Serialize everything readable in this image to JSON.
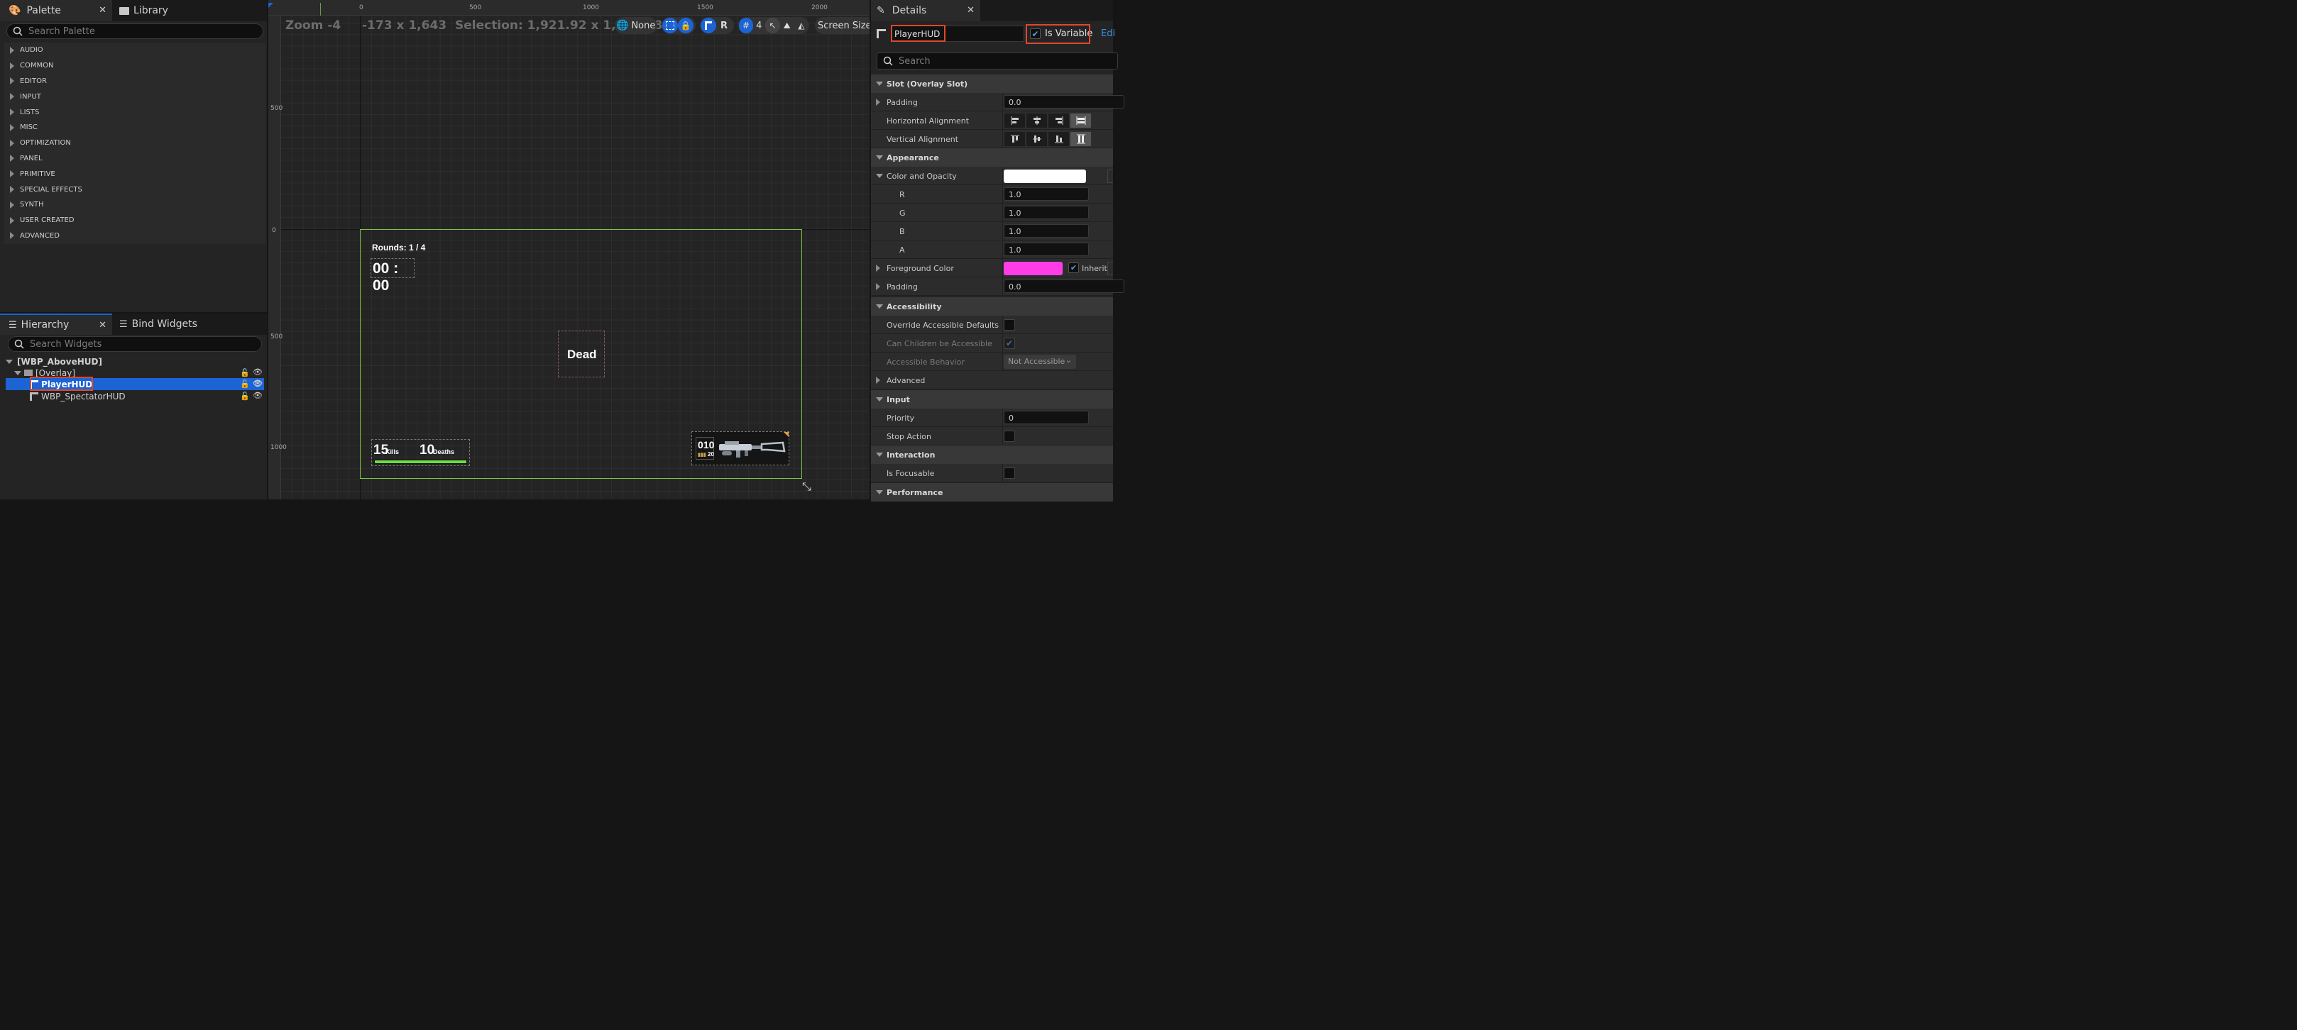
{
  "palette": {
    "tab_label": "Palette",
    "library_tab_label": "Library",
    "search_placeholder": "Search Palette",
    "categories": [
      "AUDIO",
      "COMMON",
      "EDITOR",
      "INPUT",
      "LISTS",
      "MISC",
      "OPTIMIZATION",
      "PANEL",
      "PRIMITIVE",
      "SPECIAL EFFECTS",
      "SYNTH",
      "USER CREATED",
      "ADVANCED"
    ]
  },
  "hierarchy": {
    "tab_label": "Hierarchy",
    "bind_tab_label": "Bind Widgets",
    "search_placeholder": "Search Widgets",
    "root": "[WBP_AboveHUD]",
    "overlay": "[Overlay]",
    "item_player": "PlayerHUD",
    "item_spectator": "WBP_SpectatorHUD"
  },
  "designer": {
    "zoom": "Zoom -4",
    "coords": "-173 x 1,643",
    "selection": "Selection: 1,921.92 x 1,081.08",
    "none_label": "None",
    "r_label": "R",
    "grid_count": "4",
    "screen_size": "Screen Size",
    "ruler_top": [
      "0",
      "500",
      "1000",
      "1500",
      "2000"
    ],
    "ruler_left": [
      "500",
      "0",
      "500",
      "1000"
    ]
  },
  "hud": {
    "rounds": "Rounds: 1 / 4",
    "timer": "00 : 00",
    "dead": "Dead",
    "kills_value": "15",
    "kills_label": "Kills",
    "deaths_value": "10",
    "deaths_label": "Deaths",
    "ammo_value": "010",
    "ammo_reserve": "20",
    "health_fraction": 1.0
  },
  "details": {
    "tab_label": "Details",
    "widget_name": "PlayerHUD",
    "is_variable_label": "Is Variable",
    "edit_label": "Edi",
    "search_placeholder": "Search",
    "sec_slot": "Slot (Overlay Slot)",
    "padding_label": "Padding",
    "padding_value": "0.0",
    "halign_label": "Horizontal Alignment",
    "valign_label": "Vertical Alignment",
    "sec_appearance": "Appearance",
    "color_opacity_label": "Color and Opacity",
    "r_label": "R",
    "r_value": "1.0",
    "g_label": "G",
    "g_value": "1.0",
    "b_label": "B",
    "b_value": "1.0",
    "a_label": "A",
    "a_value": "1.0",
    "fg_color_label": "Foreground Color",
    "inherit_label": "Inherit",
    "padding2_label": "Padding",
    "padding2_value": "0.0",
    "sec_accessibility": "Accessibility",
    "override_label": "Override Accessible Defaults",
    "children_label": "Can Children be Accessible",
    "behavior_label": "Accessible Behavior",
    "behavior_value": "Not Accessible",
    "advanced_label": "Advanced",
    "sec_input": "Input",
    "priority_label": "Priority",
    "priority_value": "0",
    "stop_action_label": "Stop Action",
    "sec_interaction": "Interaction",
    "focusable_label": "Is Focusable",
    "sec_performance": "Performance",
    "colors": {
      "color_opacity": "#ffffff",
      "foreground": "#ff3ce6",
      "accent": "#1c63d4",
      "canvas_border": "#7cc443",
      "highlight": "#e0472d"
    }
  }
}
